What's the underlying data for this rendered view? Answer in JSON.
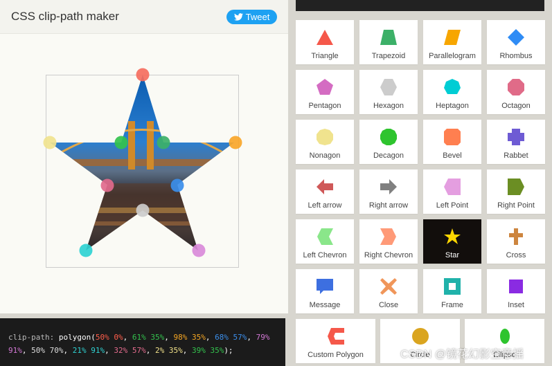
{
  "header": {
    "title": "CSS clip-path maker",
    "tweet_label": "Tweet"
  },
  "code": {
    "property": "clip-path:",
    "func": "polygon(",
    "points": [
      {
        "text": "50% 0%",
        "color": "#ff5d4a"
      },
      {
        "text": "61% 35%",
        "color": "#33c24d"
      },
      {
        "text": "98% 35%",
        "color": "#f5a623"
      },
      {
        "text": "68% 57%",
        "color": "#3b8eea"
      },
      {
        "text": "79% 91%",
        "color": "#d278d4"
      },
      {
        "text": "50% 70%",
        "color": "#dddddd"
      },
      {
        "text": "21% 91%",
        "color": "#2fd3d3"
      },
      {
        "text": "32% 57%",
        "color": "#e46c8e"
      },
      {
        "text": "2% 35%",
        "color": "#f0e08a"
      },
      {
        "text": "39% 35%",
        "color": "#33c24d"
      }
    ],
    "close": ");"
  },
  "shapes": [
    {
      "label": "Triangle",
      "icon": "triangle-icon",
      "color": "#f5584a"
    },
    {
      "label": "Trapezoid",
      "icon": "trapezoid-icon",
      "color": "#3cb068"
    },
    {
      "label": "Parallelogram",
      "icon": "parallelogram-icon",
      "color": "#f7a600"
    },
    {
      "label": "Rhombus",
      "icon": "rhombus-icon",
      "color": "#2f8cf5"
    },
    {
      "label": "Pentagon",
      "icon": "pentagon-icon",
      "color": "#d46cc2"
    },
    {
      "label": "Hexagon",
      "icon": "hexagon-icon",
      "color": "#cccccc"
    },
    {
      "label": "Heptagon",
      "icon": "heptagon-icon",
      "color": "#00cdd4"
    },
    {
      "label": "Octagon",
      "icon": "octagon-icon",
      "color": "#e06b88"
    },
    {
      "label": "Nonagon",
      "icon": "nonagon-icon",
      "color": "#f0e38e"
    },
    {
      "label": "Decagon",
      "icon": "decagon-icon",
      "color": "#2ec42e"
    },
    {
      "label": "Bevel",
      "icon": "bevel-icon",
      "color": "#ff7f50"
    },
    {
      "label": "Rabbet",
      "icon": "rabbet-icon",
      "color": "#6e5bd4"
    },
    {
      "label": "Left arrow",
      "icon": "left-arrow-icon",
      "color": "#cf5858"
    },
    {
      "label": "Right arrow",
      "icon": "right-arrow-icon",
      "color": "#808080"
    },
    {
      "label": "Left Point",
      "icon": "left-point-icon",
      "color": "#e49ee0"
    },
    {
      "label": "Right Point",
      "icon": "right-point-icon",
      "color": "#6b8e23"
    },
    {
      "label": "Left Chevron",
      "icon": "left-chevron-icon",
      "color": "#8ae68a"
    },
    {
      "label": "Right Chevron",
      "icon": "right-chevron-icon",
      "color": "#ff9a78"
    },
    {
      "label": "Star",
      "icon": "star-icon",
      "color": "#ffd700"
    },
    {
      "label": "Cross",
      "icon": "cross-icon",
      "color": "#cd853f"
    },
    {
      "label": "Message",
      "icon": "message-icon",
      "color": "#3d6fe0"
    },
    {
      "label": "Close",
      "icon": "close-icon",
      "color": "#f0965a"
    },
    {
      "label": "Frame",
      "icon": "frame-icon",
      "color": "#20b2aa"
    },
    {
      "label": "Inset",
      "icon": "inset-icon",
      "color": "#8a2be2"
    },
    {
      "label": "Custom Polygon",
      "icon": "custom-polygon-icon",
      "color": "#f5584a"
    },
    {
      "label": "Circle",
      "icon": "circle-icon",
      "color": "#daa520"
    },
    {
      "label": "Ellipse",
      "icon": "ellipse-icon",
      "color": "#2ec42e"
    }
  ],
  "selected_shape": "Star",
  "handles": [
    {
      "name": "handle-top",
      "color": "#f56e5e"
    },
    {
      "name": "handle-inner-right-top",
      "color": "#3cb068"
    },
    {
      "name": "handle-right",
      "color": "#f8a629"
    },
    {
      "name": "handle-inner-right",
      "color": "#3b8eea"
    },
    {
      "name": "handle-bottom-right",
      "color": "#d98ad9"
    },
    {
      "name": "handle-inner-bottom",
      "color": "#cccccc"
    },
    {
      "name": "handle-bottom-left",
      "color": "#2fd3d3"
    },
    {
      "name": "handle-inner-left",
      "color": "#e16a8c"
    },
    {
      "name": "handle-left",
      "color": "#f0e38e"
    },
    {
      "name": "handle-inner-left-top",
      "color": "#33c24d"
    }
  ],
  "watermark": "CSDN @镜花幻影空意揺"
}
